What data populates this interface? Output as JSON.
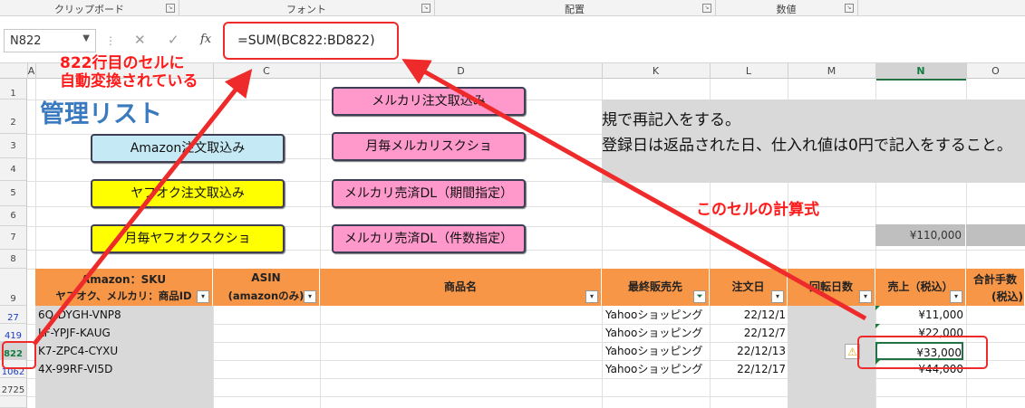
{
  "ribbon": {
    "groups": [
      "クリップボード",
      "フォント",
      "配置",
      "数値"
    ]
  },
  "formula_bar": {
    "name_box": "N822",
    "cancel_icon": "✕",
    "enter_icon": "✓",
    "fx_label": "fx",
    "formula": "=SUM(BC822:BD822)"
  },
  "columns": [
    "A",
    "C",
    "D",
    "K",
    "L",
    "M",
    "N",
    "O"
  ],
  "rows": [
    "1",
    "2",
    "3",
    "4",
    "5",
    "6",
    "7",
    "8",
    "9",
    "27",
    "419",
    "822",
    "1062",
    "2725"
  ],
  "sheet": {
    "title": "管理リスト",
    "note_lines": [
      "規で再記入をする。",
      "登録日は返品された日、仕入れ値は0円で記入をすること。"
    ],
    "total_value": "¥110,000"
  },
  "buttons": {
    "amazon_import": "Amazon注文取込み",
    "yafuoku_import": "ヤフオク注文取込み",
    "yafuoku_screenshot": "月毎ヤフオクスクショ",
    "mercari_import": "メルカリ注文取込み",
    "mercari_screenshot": "月毎メルカリスクショ",
    "mercari_dl_period": "メルカリ売済DL（期間指定）",
    "mercari_dl_count": "メルカリ売済DL（件数指定）"
  },
  "table": {
    "headers": {
      "sku_line1": "Amazon：SKU",
      "sku_line2": "ヤフオク、メルカリ：商品ID",
      "asin_line1": "ASIN",
      "asin_line2": "(amazonのみ)",
      "product": "商品名",
      "last_seller": "最終販売先",
      "order_date": "注文日",
      "turnover_days": "回転日数",
      "sales": "売上（税込）",
      "fee_line1": "合計手数",
      "fee_line2": "(税込)"
    },
    "rows": [
      {
        "sku": "6Q-DYGH-VNP8",
        "seller": "Yahooショッピング",
        "date": "22/12/1",
        "sales": "¥11,000"
      },
      {
        "sku": "LF-YPJF-KAUG",
        "seller": "Yahooショッピング",
        "date": "22/12/7",
        "sales": "¥22,000"
      },
      {
        "sku": "K7-ZPC4-CYXU",
        "seller": "Yahooショッピング",
        "date": "22/12/13",
        "sales": "¥33,000"
      },
      {
        "sku": "4X-99RF-VI5D",
        "seller": "Yahooショッピング",
        "date": "22/12/17",
        "sales": "¥44,000"
      }
    ]
  },
  "annotations": {
    "row_note_line1": "822行目のセルに",
    "row_note_line2": "自動変換されている",
    "formula_note": "このセルの計算式"
  },
  "colors": {
    "header_orange": "#f79646",
    "annotation_red": "#ef2a2a",
    "title_blue": "#3a7bbf"
  },
  "icons": {
    "warning": "⚠",
    "filter": "▾"
  }
}
